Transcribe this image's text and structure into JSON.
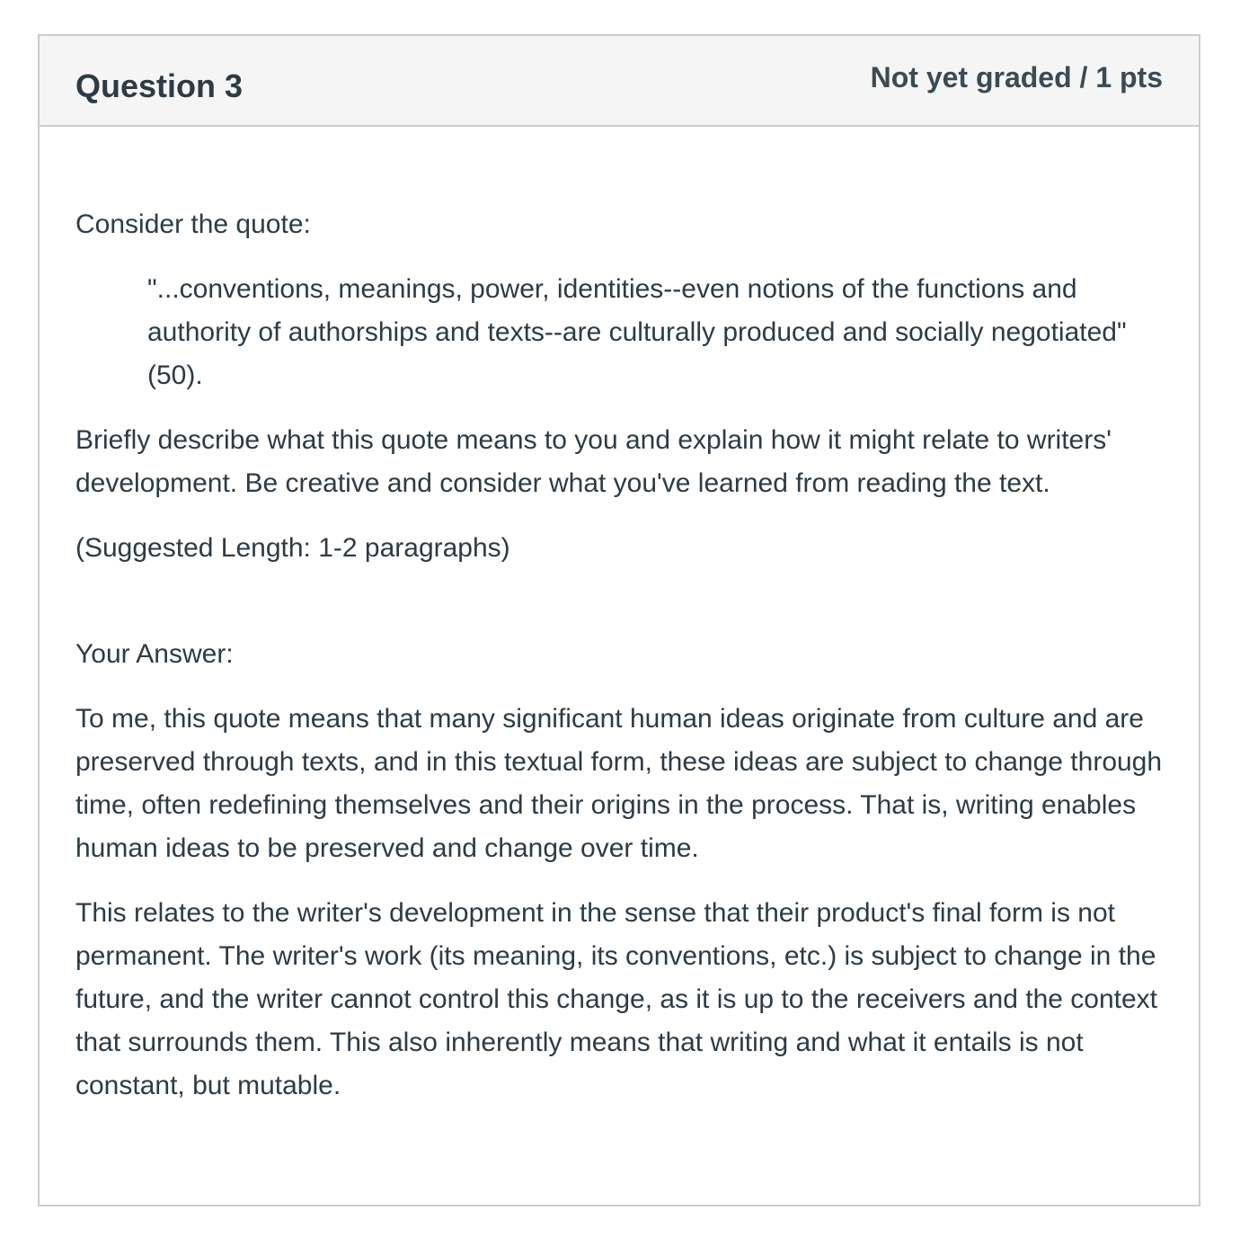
{
  "question": {
    "title": "Question 3",
    "points_status": "Not yet graded / 1 pts"
  },
  "prompt": {
    "intro": "Consider the quote:",
    "quote": "\"...conventions, meanings, power, identities--even notions of the functions and authority of authorships and texts--are culturally produced and socially negotiated\" (50).",
    "instructions": "Briefly describe what this quote means to you and explain how it might relate to writers' development. Be creative and consider what you've learned from reading the text.",
    "suggested_length": "(Suggested Length: 1-2 paragraphs)"
  },
  "answer": {
    "label": "Your Answer:",
    "paragraphs": [
      "To me, this quote means that many significant human ideas originate from culture and are preserved through texts, and in this textual form, these ideas are subject to change through time, often redefining themselves and their origins in the process. That is, writing enables human ideas to be preserved and change over time.",
      "This relates to the writer's development in the sense that their product's final form is not permanent. The writer's work (its meaning, its conventions, etc.) is subject to change in the future, and the writer cannot control this change, as it is up to the receivers and the context that surrounds them. This also inherently means that writing and what it entails is not constant, but mutable."
    ]
  }
}
